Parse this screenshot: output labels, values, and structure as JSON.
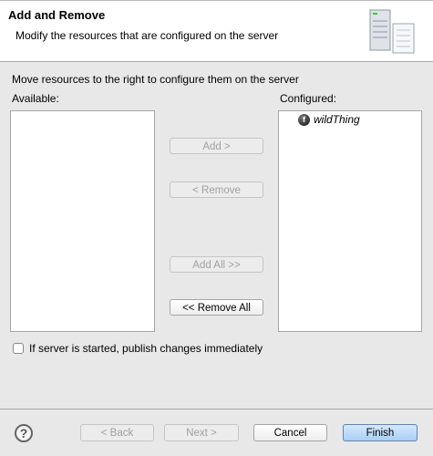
{
  "header": {
    "title": "Add and Remove",
    "subtitle": "Modify the resources that are configured on the server",
    "icon": "server-icon"
  },
  "instructions": "Move resources to the right to configure them on the server",
  "available": {
    "label": "Available:",
    "items": []
  },
  "configured": {
    "label": "Configured:",
    "items": [
      {
        "label": "wildThing",
        "icon": "module-icon"
      }
    ]
  },
  "buttons": {
    "add": "Add >",
    "remove": "< Remove",
    "add_all": "Add All >>",
    "remove_all": "<< Remove All"
  },
  "publish_checkbox": {
    "label": "If server is started, publish changes immediately",
    "checked": false
  },
  "footer": {
    "help": "?",
    "back": "< Back",
    "next": "Next >",
    "cancel": "Cancel",
    "finish": "Finish"
  }
}
